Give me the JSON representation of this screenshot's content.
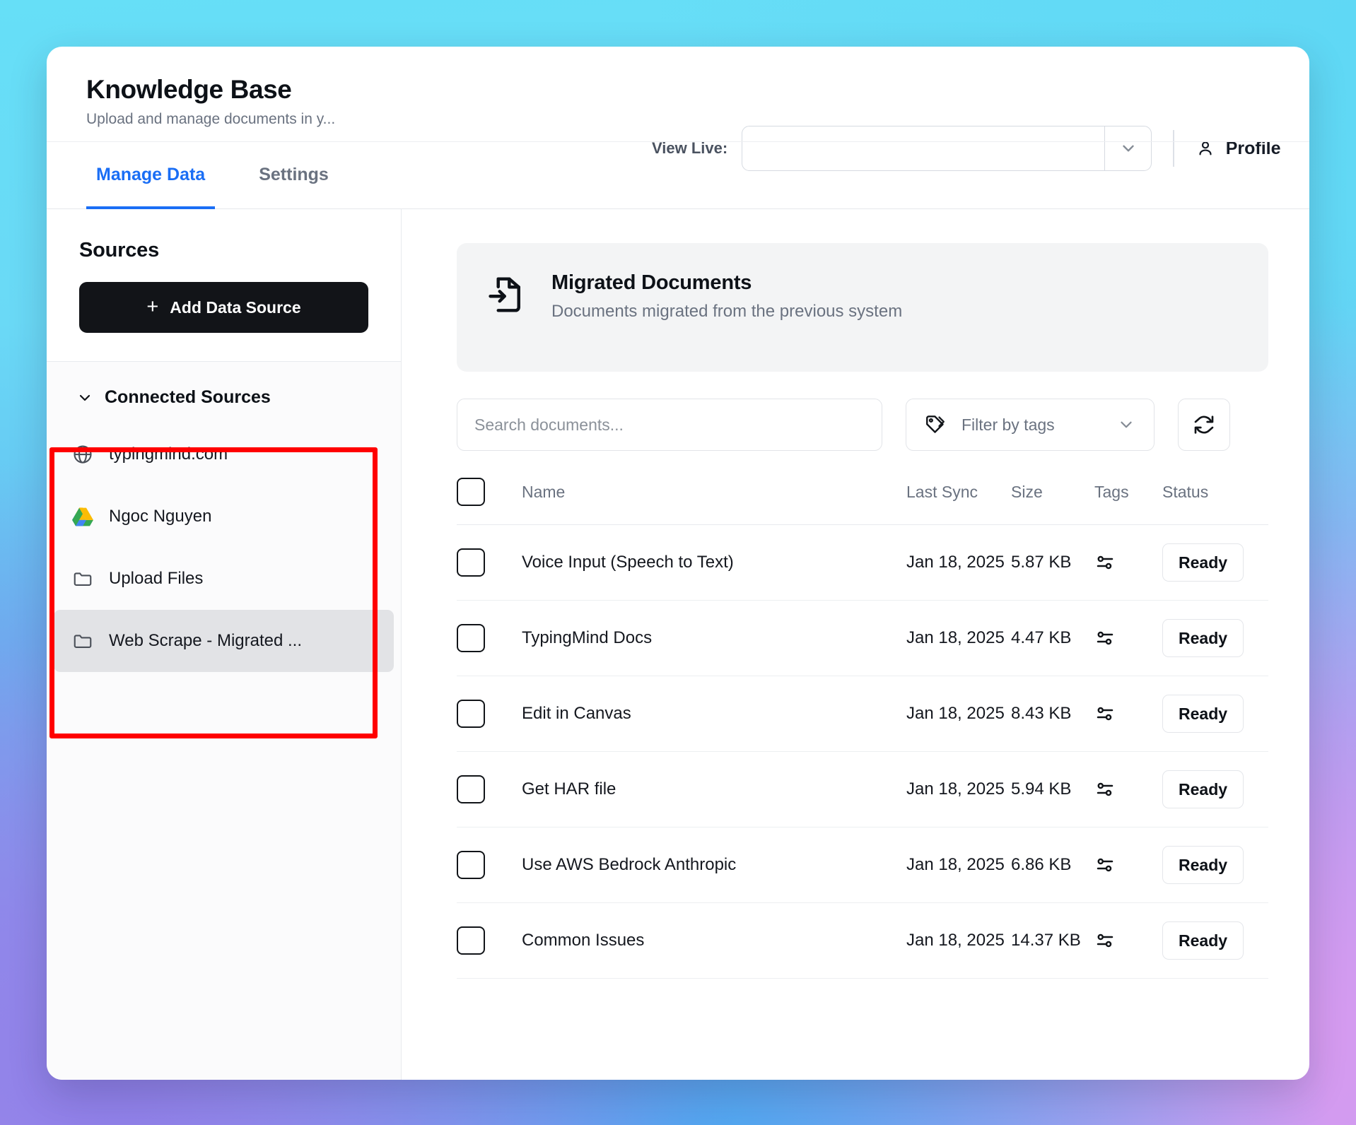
{
  "header": {
    "title": "Knowledge Base",
    "subtitle": "Upload and manage documents in y...",
    "view_live_label": "View Live:",
    "view_live_value": "",
    "profile_label": "Profile"
  },
  "tabs": [
    {
      "label": "Manage Data",
      "active": true
    },
    {
      "label": "Settings",
      "active": false
    }
  ],
  "sidebar": {
    "heading": "Sources",
    "add_button_label": "Add Data Source",
    "add_button_plus": "+",
    "group_label": "Connected Sources",
    "items": [
      {
        "label": "typingmind.com",
        "icon": "globe-icon",
        "selected": false
      },
      {
        "label": "Ngoc Nguyen",
        "icon": "google-drive-icon",
        "selected": false
      },
      {
        "label": "Upload Files",
        "icon": "folder-icon",
        "selected": false
      },
      {
        "label": "Web Scrape - Migrated ...",
        "icon": "folder-icon",
        "selected": true
      }
    ]
  },
  "main": {
    "info_card": {
      "title": "Migrated Documents",
      "description": "Documents migrated from the previous system",
      "icon": "file-import-icon"
    },
    "toolbar": {
      "search_placeholder": "Search documents...",
      "search_value": "",
      "tag_filter_label": "Filter by tags",
      "refresh_label": "refresh-icon"
    },
    "table": {
      "columns": [
        "",
        "Name",
        "Last Sync",
        "Size",
        "Tags",
        "Status"
      ],
      "rows": [
        {
          "name": "Voice Input (Speech to Text)",
          "last_sync": "Jan 18, 2025",
          "size": "5.87 KB",
          "tags": "sliders-icon",
          "status": "Ready"
        },
        {
          "name": "TypingMind Docs",
          "last_sync": "Jan 18, 2025",
          "size": "4.47 KB",
          "tags": "sliders-icon",
          "status": "Ready"
        },
        {
          "name": "Edit in Canvas",
          "last_sync": "Jan 18, 2025",
          "size": "8.43 KB",
          "tags": "sliders-icon",
          "status": "Ready"
        },
        {
          "name": "Get HAR file",
          "last_sync": "Jan 18, 2025",
          "size": "5.94 KB",
          "tags": "sliders-icon",
          "status": "Ready"
        },
        {
          "name": "Use AWS Bedrock Anthropic",
          "last_sync": "Jan 18, 2025",
          "size": "6.86 KB",
          "tags": "sliders-icon",
          "status": "Ready"
        },
        {
          "name": "Common Issues",
          "last_sync": "Jan 18, 2025",
          "size": "14.37 KB",
          "tags": "sliders-icon",
          "status": "Ready"
        }
      ]
    }
  },
  "annotation": {
    "highlight_color": "#ff0000",
    "target": "Connected Sources list"
  },
  "colors": {
    "accent": "#1a6ef5",
    "button_dark": "#121418",
    "selected_row": "#e2e3e6",
    "card_bg": "#f3f4f5"
  }
}
